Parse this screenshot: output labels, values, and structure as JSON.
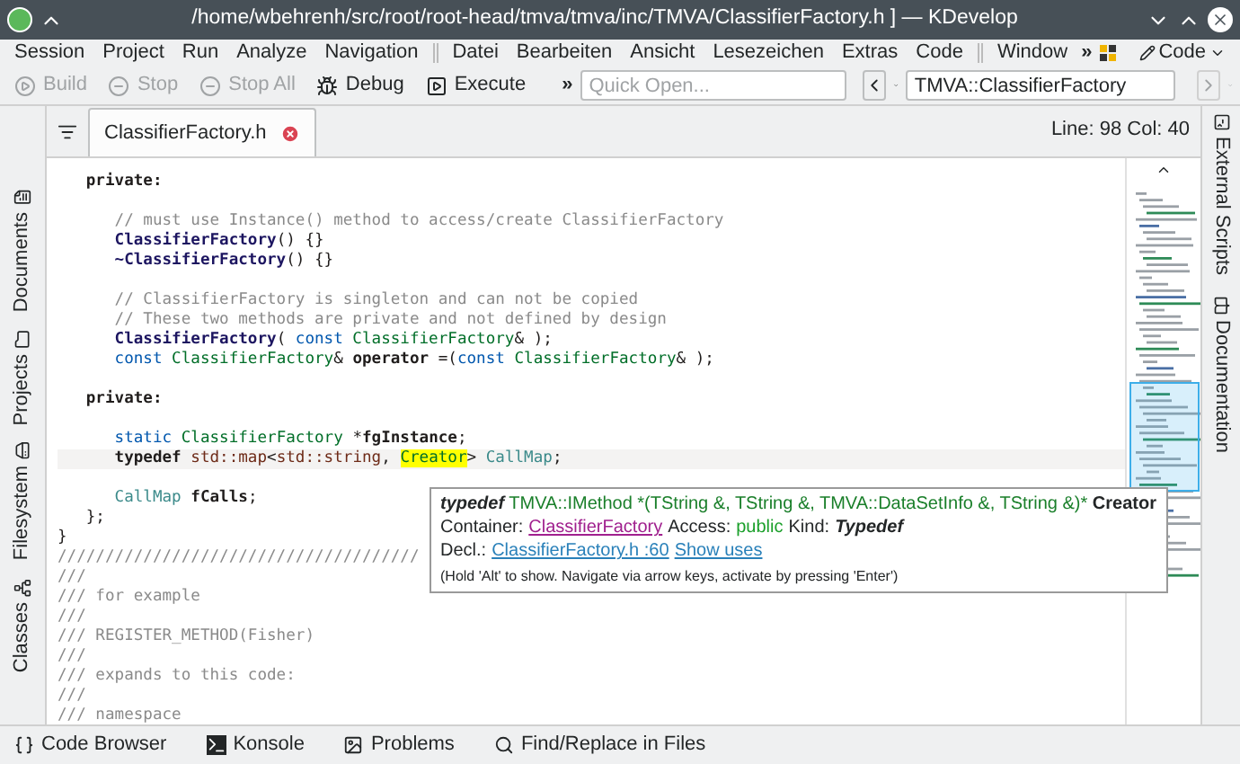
{
  "window": {
    "title": "/home/wbehrenh/src/root/root-head/tmva/tmva/inc/TMVA/ClassifierFactory.h ] — KDevelop"
  },
  "menu": {
    "groups": [
      [
        "Session",
        "Project",
        "Run",
        "Analyze",
        "Navigation"
      ],
      [
        "Datei",
        "Bearbeiten",
        "Ansicht",
        "Lesezeichen",
        "Extras",
        "Code"
      ],
      [
        "Window"
      ]
    ],
    "overflow": "»",
    "area": "Code"
  },
  "toolbar": {
    "buttons": [
      {
        "label": "Build",
        "kind": "build",
        "disabled": true
      },
      {
        "label": "Stop",
        "kind": "stop",
        "disabled": true
      },
      {
        "label": "Stop All",
        "kind": "stop",
        "disabled": true
      },
      {
        "label": "Debug",
        "kind": "debug",
        "disabled": false
      },
      {
        "label": "Execute",
        "kind": "execute",
        "disabled": false
      }
    ],
    "overflow": "»",
    "quick_open": {
      "placeholder": "Quick Open..."
    },
    "context": {
      "value": "TMVA::ClassifierFactory"
    }
  },
  "left_dock": [
    {
      "label": "Documents",
      "selected": false
    },
    {
      "label": "Projects",
      "selected": false
    },
    {
      "label": "Filesystem",
      "selected": false
    },
    {
      "label": "Classes",
      "selected": false
    }
  ],
  "right_dock": [
    {
      "label": "External Scripts",
      "selected": false
    },
    {
      "label": "Documentation",
      "selected": false
    }
  ],
  "tabs": [
    {
      "label": "ClassifierFactory.h",
      "selected": true
    }
  ],
  "cursor_position": "Line: 98 Col: 40",
  "code": {
    "lines": [
      {
        "current": false,
        "gap_before": false,
        "tokens": [
          {
            "t": "   private:",
            "kind": "kw"
          }
        ]
      },
      {
        "current": false,
        "gap_before": true,
        "tokens": [
          {
            "t": "      // must use Instance() method to access/create ClassifierFactory",
            "kind": "cm"
          }
        ]
      },
      {
        "current": false,
        "gap_before": false,
        "tokens": [
          {
            "t": "      ClassifierFactory",
            "kind": "fn"
          },
          {
            "t": "() {}",
            "kind": "plain"
          }
        ]
      },
      {
        "current": false,
        "gap_before": false,
        "tokens": [
          {
            "t": "      ~ClassifierFactory",
            "kind": "fn"
          },
          {
            "t": "() {}",
            "kind": "plain"
          }
        ]
      },
      {
        "current": false,
        "gap_before": true,
        "tokens": [
          {
            "t": "      // ClassifierFactory is singleton and can not be copied",
            "kind": "cm"
          }
        ]
      },
      {
        "current": false,
        "gap_before": false,
        "tokens": [
          {
            "t": "      // These two methods are private and not defined by design",
            "kind": "cm"
          }
        ]
      },
      {
        "current": false,
        "gap_before": false,
        "tokens": [
          {
            "t": "      ClassifierFactory",
            "kind": "fn"
          },
          {
            "t": "( ",
            "kind": "plain"
          },
          {
            "t": "const",
            "kind": "kwb"
          },
          {
            "t": " ClassifierFactory",
            "kind": "type"
          },
          {
            "t": "& );",
            "kind": "plain"
          }
        ]
      },
      {
        "current": false,
        "gap_before": false,
        "tokens": [
          {
            "t": "      const",
            "kind": "kwb"
          },
          {
            "t": " ClassifierFactory",
            "kind": "type"
          },
          {
            "t": "& ",
            "kind": "plain"
          },
          {
            "t": "operator",
            "kind": "kw"
          },
          {
            "t": " =(",
            "kind": "plain"
          },
          {
            "t": "const",
            "kind": "kwb"
          },
          {
            "t": " ClassifierFactory",
            "kind": "type"
          },
          {
            "t": "& );",
            "kind": "plain"
          }
        ]
      },
      {
        "current": false,
        "gap_before": true,
        "tokens": [
          {
            "t": "   private:",
            "kind": "kw"
          }
        ]
      },
      {
        "current": false,
        "gap_before": true,
        "tokens": [
          {
            "t": "      static",
            "kind": "kwb"
          },
          {
            "t": " ClassifierFactory",
            "kind": "type"
          },
          {
            "t": " *",
            "kind": "plain"
          },
          {
            "t": "fgInstance",
            "kind": "kw"
          },
          {
            "t": ";",
            "kind": "plain"
          }
        ]
      },
      {
        "current": true,
        "gap_before": false,
        "tokens": [
          {
            "t": "      typedef",
            "kind": "kw"
          },
          {
            "t": " std::map",
            "kind": "std"
          },
          {
            "t": "<",
            "kind": "plain"
          },
          {
            "t": "std::string",
            "kind": "std"
          },
          {
            "t": ", ",
            "kind": "plain"
          },
          {
            "t": "Creator",
            "kind": "hl"
          },
          {
            "t": "> ",
            "kind": "plain"
          },
          {
            "t": "CallMap",
            "kind": "member"
          },
          {
            "t": ";",
            "kind": "plain"
          }
        ]
      },
      {
        "current": false,
        "gap_before": true,
        "tokens": [
          {
            "t": "      CallMap",
            "kind": "member"
          },
          {
            "t": " fCalls",
            "kind": "kw"
          },
          {
            "t": ";",
            "kind": "plain"
          }
        ]
      },
      {
        "current": false,
        "gap_before": false,
        "tokens": [
          {
            "t": "   };",
            "kind": "plain"
          }
        ]
      },
      {
        "current": false,
        "gap_before": false,
        "tokens": [
          {
            "t": "}",
            "kind": "plain"
          }
        ]
      },
      {
        "current": false,
        "gap_before": false,
        "tokens": [
          {
            "t": "//////////////////////////////////////",
            "kind": "cm"
          }
        ]
      },
      {
        "current": false,
        "gap_before": false,
        "tokens": [
          {
            "t": "///",
            "kind": "cm"
          }
        ]
      },
      {
        "current": false,
        "gap_before": false,
        "tokens": [
          {
            "t": "/// for example",
            "kind": "cm"
          }
        ]
      },
      {
        "current": false,
        "gap_before": false,
        "tokens": [
          {
            "t": "///",
            "kind": "cm"
          }
        ]
      },
      {
        "current": false,
        "gap_before": false,
        "tokens": [
          {
            "t": "/// REGISTER_METHOD(Fisher)",
            "kind": "cm"
          }
        ]
      },
      {
        "current": false,
        "gap_before": false,
        "tokens": [
          {
            "t": "///",
            "kind": "cm"
          }
        ]
      },
      {
        "current": false,
        "gap_before": false,
        "tokens": [
          {
            "t": "/// expands to this code:",
            "kind": "cm"
          }
        ]
      },
      {
        "current": false,
        "gap_before": false,
        "tokens": [
          {
            "t": "///",
            "kind": "cm"
          }
        ]
      },
      {
        "current": false,
        "gap_before": false,
        "tokens": [
          {
            "t": "/// namespace",
            "kind": "cm"
          }
        ]
      }
    ]
  },
  "tooltip": {
    "signature": [
      {
        "t": "typedef",
        "kind": "bi"
      },
      {
        "t": " TMVA::IMethod *(TString &, TString &, TMVA::DataSetInfo &, TString &)*",
        "kind": "green"
      },
      {
        "t": " Creator",
        "kind": "b"
      }
    ],
    "container_label": "Container:",
    "container": "ClassifierFactory",
    "access_label": "Access:",
    "access": "public",
    "kind_label": "Kind:",
    "kind": "Typedef",
    "decl_label": "Decl.:",
    "decl": "ClassifierFactory.h :60",
    "show_uses": "Show uses",
    "hint": "(Hold 'Alt' to show. Navigate via arrow keys, activate by pressing 'Enter')"
  },
  "bottom_dock": [
    {
      "label": "Code Browser",
      "kind": "braces",
      "selected": false
    },
    {
      "label": "Konsole",
      "kind": "terminal",
      "selected": false
    },
    {
      "label": "Problems",
      "kind": "problems",
      "selected": false
    },
    {
      "label": "Find/Replace in Files",
      "kind": "search",
      "selected": false
    }
  ]
}
